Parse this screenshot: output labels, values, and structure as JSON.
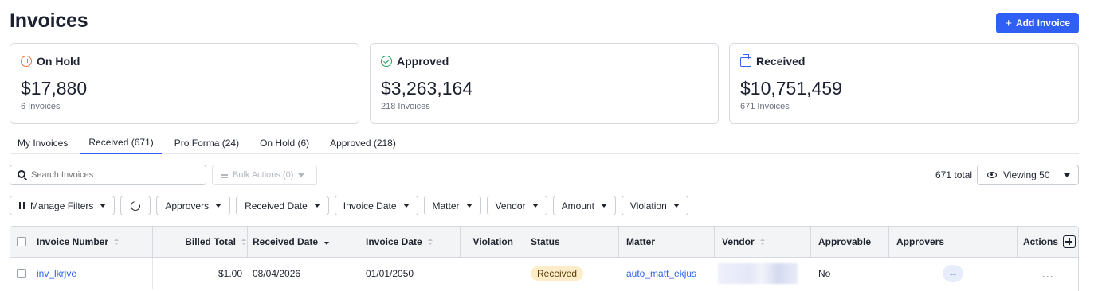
{
  "page": {
    "title": "Invoices",
    "add_button": "Add Invoice"
  },
  "summary": [
    {
      "label": "On Hold",
      "amount": "$17,880",
      "count": "6 Invoices",
      "icon": "pause-circle-icon",
      "color": "#e8743b"
    },
    {
      "label": "Approved",
      "amount": "$3,263,164",
      "count": "218 Invoices",
      "icon": "check-circle-icon",
      "color": "#22a05b"
    },
    {
      "label": "Received",
      "amount": "$10,751,459",
      "count": "671 Invoices",
      "icon": "inbox-icon",
      "color": "#3a63e8"
    }
  ],
  "tabs": [
    {
      "label": "My Invoices",
      "active": false
    },
    {
      "label": "Received (671)",
      "active": true
    },
    {
      "label": "Pro Forma (24)",
      "active": false
    },
    {
      "label": "On Hold (6)",
      "active": false
    },
    {
      "label": "Approved (218)",
      "active": false
    }
  ],
  "toolbar": {
    "search_placeholder": "Search Invoices",
    "bulk_actions": "Bulk Actions (0)",
    "total": "671 total",
    "viewing": "Viewing 50"
  },
  "filters": {
    "manage": "Manage Filters",
    "items": [
      "Approvers",
      "Received Date",
      "Invoice Date",
      "Matter",
      "Vendor",
      "Amount",
      "Violation"
    ]
  },
  "table": {
    "columns": {
      "invoice_number": "Invoice Number",
      "billed_total": "Billed Total",
      "received_date": "Received Date",
      "invoice_date": "Invoice Date",
      "violation": "Violation",
      "status": "Status",
      "matter": "Matter",
      "vendor": "Vendor",
      "approvable": "Approvable",
      "approvers": "Approvers",
      "actions": "Actions"
    },
    "rows": [
      {
        "invoice_number": "inv_lkrjve",
        "billed_total": "$1.00",
        "received_date": "08/04/2026",
        "invoice_date": "01/01/2050",
        "violation": "",
        "status": "Received",
        "matter": "auto_matt_ekjus",
        "vendor": "",
        "approvable": "No",
        "approvers": "--",
        "actions": "..."
      }
    ]
  },
  "colors": {
    "accent": "#2f5ff5",
    "status_received_bg": "#fdecc8"
  }
}
